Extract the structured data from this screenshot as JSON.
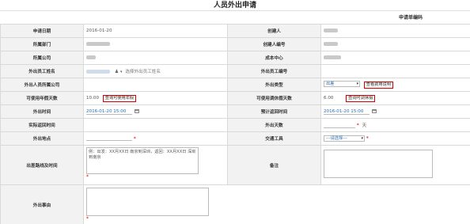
{
  "page": {
    "title": "人员外出申请",
    "serial_label": "申请单编码"
  },
  "fields": {
    "apply_date_label": "申请日期",
    "apply_date_value": "2016-01-20",
    "creator_label": "创建人",
    "dept_label": "所属部门",
    "creator_no_label": "创建人编号",
    "company_label": "所属公司",
    "cost_center_label": "成本中心",
    "out_person_label": "外出员工姓名",
    "out_person_hint": "选择外出员工姓名",
    "out_person_no_label": "外出员工编号",
    "out_company_label": "外出人员所属公司",
    "out_type_label": "外出类型",
    "out_type_value": "出差",
    "out_type_btn": "查看费用说明",
    "annual_leave_label": "可使用年假天数",
    "annual_leave_value": "10.00",
    "annual_leave_btn": "查询可使用年假",
    "adjust_leave_label": "可使用调休假天数",
    "adjust_leave_value": "6.00",
    "adjust_leave_btn": "查询可调休假",
    "out_time_label": "外出时间",
    "out_time_value": "2016-01-20 15:00",
    "return_time_label": "预计返回时间",
    "return_time_value": "2016-01-20 15:00",
    "actual_return_label": "实际返回时间",
    "out_days_label": "外出天数",
    "out_days_unit": "天",
    "out_place_label": "外出地点",
    "transport_label": "交通工具",
    "transport_placeholder": "---请选择---",
    "route_label": "出差路线及时间",
    "route_example": "例：出发：XX月XX日 南京到深圳，返回：XX月XX日 深圳到南京",
    "remark_label": "备注",
    "reason_label": "外出事由"
  },
  "colors": {
    "accent_red": "#d40000",
    "label_bg": "#f2f2f2",
    "link_blue": "#2a6ab0"
  }
}
